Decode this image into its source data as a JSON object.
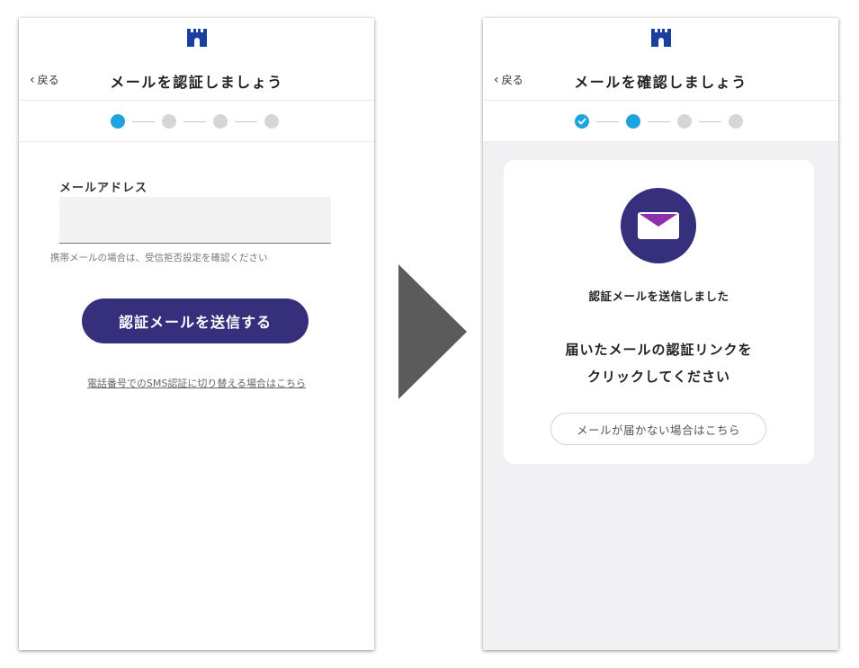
{
  "colors": {
    "brand_navy": "#362f7c",
    "step_active": "#1da4dd",
    "step_inactive": "#d6d6d6",
    "logo_blue": "#1a3f9e",
    "arrow_gray": "#5b5b5b"
  },
  "left_screen": {
    "back_label": "戻る",
    "title": "メールを認証しましょう",
    "steps": [
      "active",
      "pending",
      "pending",
      "pending"
    ],
    "email_label": "メールアドレス",
    "email_value": "",
    "email_hint": "携帯メールの場合は、受信拒否設定を確認ください",
    "send_button_label": "認証メールを送信する",
    "sms_link": "電話番号でのSMS認証に切り替える場合はこちら"
  },
  "right_screen": {
    "back_label": "戻る",
    "title": "メールを確認しましょう",
    "steps": [
      "done",
      "active",
      "pending",
      "pending"
    ],
    "sent_message": "認証メールを送信しました",
    "instruction_line1": "届いたメールの認証リンクを",
    "instruction_line2": "クリックしてください",
    "no_mail_button_label": "メールが届かない場合はこちら"
  },
  "icons": {
    "logo": "castle-logo-icon",
    "back": "chevron-left-icon",
    "mail": "envelope-icon",
    "check": "check-icon",
    "transition": "play-arrow-icon"
  }
}
